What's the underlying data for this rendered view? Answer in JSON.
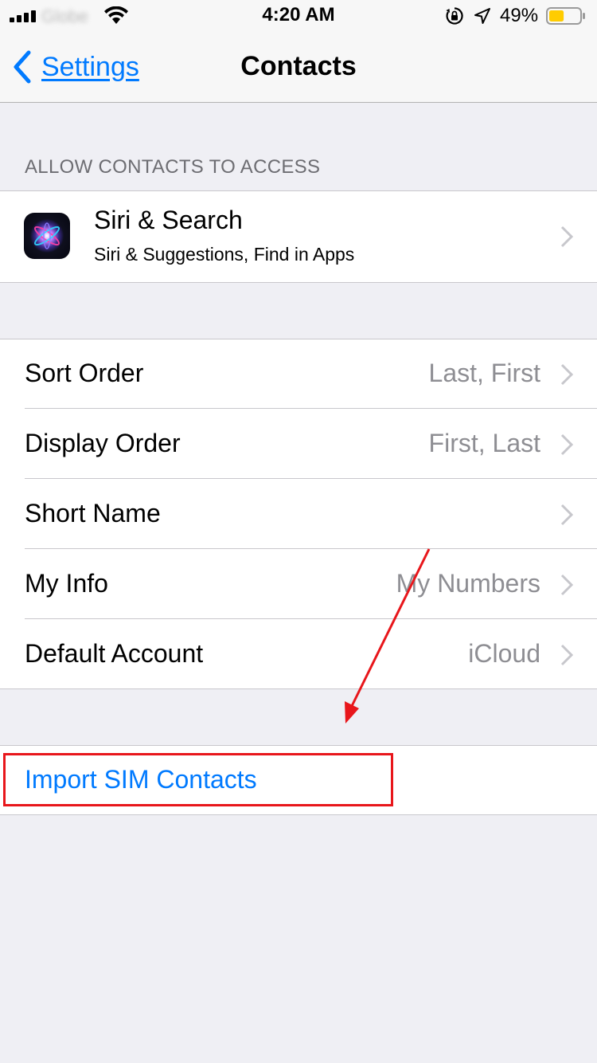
{
  "status_bar": {
    "carrier": "Globe",
    "time": "4:20 AM",
    "battery_percent": "49%",
    "battery_level": 0.49,
    "battery_color": "#ffcc00",
    "icons": [
      "signal-icon",
      "wifi-icon",
      "rotation-lock-icon",
      "location-icon",
      "battery-icon"
    ]
  },
  "nav": {
    "back_label": "Settings",
    "title": "Contacts"
  },
  "siri_section": {
    "header": "ALLOW CONTACTS TO ACCESS",
    "item": {
      "title": "Siri & Search",
      "subtitle": "Siri & Suggestions, Find in Apps",
      "icon": "siri-icon"
    }
  },
  "settings": {
    "rows": [
      {
        "label": "Sort Order",
        "value": "Last, First"
      },
      {
        "label": "Display Order",
        "value": "First, Last"
      },
      {
        "label": "Short Name",
        "value": ""
      },
      {
        "label": "My Info",
        "value": "My Numbers"
      },
      {
        "label": "Default Account",
        "value": "iCloud"
      }
    ]
  },
  "import": {
    "label": "Import SIM Contacts"
  },
  "colors": {
    "accent": "#007aff",
    "annotation": "#e8161b",
    "secondary_text": "#8e8e93",
    "background": "#efeff4"
  }
}
